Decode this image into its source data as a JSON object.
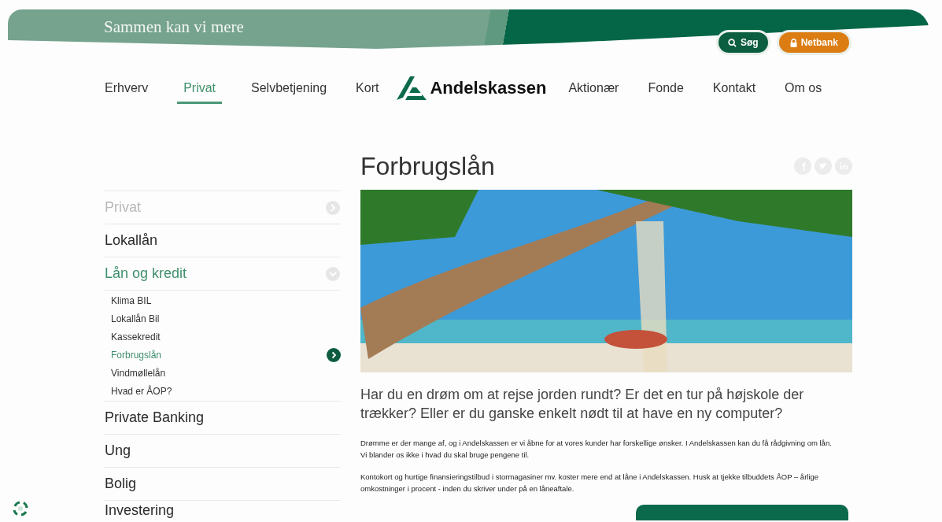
{
  "banner": {
    "tagline": "Sammen kan vi mere",
    "search_button": "Søg",
    "netbank_button": "Netbank"
  },
  "nav": {
    "left": [
      {
        "label": "Erhverv",
        "selected": false
      },
      {
        "label": "Privat",
        "selected": true
      },
      {
        "label": "Selvbetjening",
        "selected": false
      },
      {
        "label": "Kort",
        "selected": false
      }
    ],
    "logo": "Andelskassen",
    "right": [
      {
        "label": "Aktionær",
        "selected": false
      },
      {
        "label": "Fonde",
        "selected": false
      },
      {
        "label": "Kontakt",
        "selected": false
      },
      {
        "label": "Om os",
        "selected": false
      }
    ]
  },
  "sidebar": {
    "items": [
      {
        "label": "Privat",
        "kind": "parent",
        "selected": false,
        "expanded": false
      },
      {
        "label": "Lokallån",
        "kind": "item",
        "selected": false,
        "expanded": false
      },
      {
        "label": "Lån og kredit",
        "kind": "item",
        "selected": true,
        "expanded": true,
        "children": [
          {
            "label": "Klima BIL",
            "selected": false
          },
          {
            "label": "Lokallån Bil",
            "selected": false
          },
          {
            "label": "Kassekredit",
            "selected": false
          },
          {
            "label": "Forbrugslån",
            "selected": true
          },
          {
            "label": "Vindmøllelån",
            "selected": false
          },
          {
            "label": "Hvad er ÅOP?",
            "selected": false
          }
        ]
      },
      {
        "label": "Private Banking",
        "kind": "item",
        "selected": false,
        "expanded": false
      },
      {
        "label": "Ung",
        "kind": "item",
        "selected": false,
        "expanded": false
      },
      {
        "label": "Bolig",
        "kind": "item",
        "selected": false,
        "expanded": false
      },
      {
        "label": "Investering",
        "kind": "item",
        "selected": false,
        "expanded": false
      }
    ]
  },
  "content": {
    "title": "Forbrugslån",
    "lead": "Har du en drøm om at rejse jorden rundt? Er det en tur på højskole der trækker? Eller er du ganske enkelt nødt til at have en ny computer?",
    "paragraphs": [
      "Drømme er der mange af, og i Andelskassen er vi åbne for at vores kunder har forskellige ønsker. I Andelskassen kan du få rådgivning om lån. Vi blander os ikke i hvad du skal bruge pengene til.",
      "Kontokort og hurtige finansieringstilbud i stormagasiner mv. koster mere end at låne i Andelskassen. Husk at tjekke tilbuddets ÅOP – årlige omkostninger i procent - inden du skriver under på en låneaftale."
    ]
  }
}
